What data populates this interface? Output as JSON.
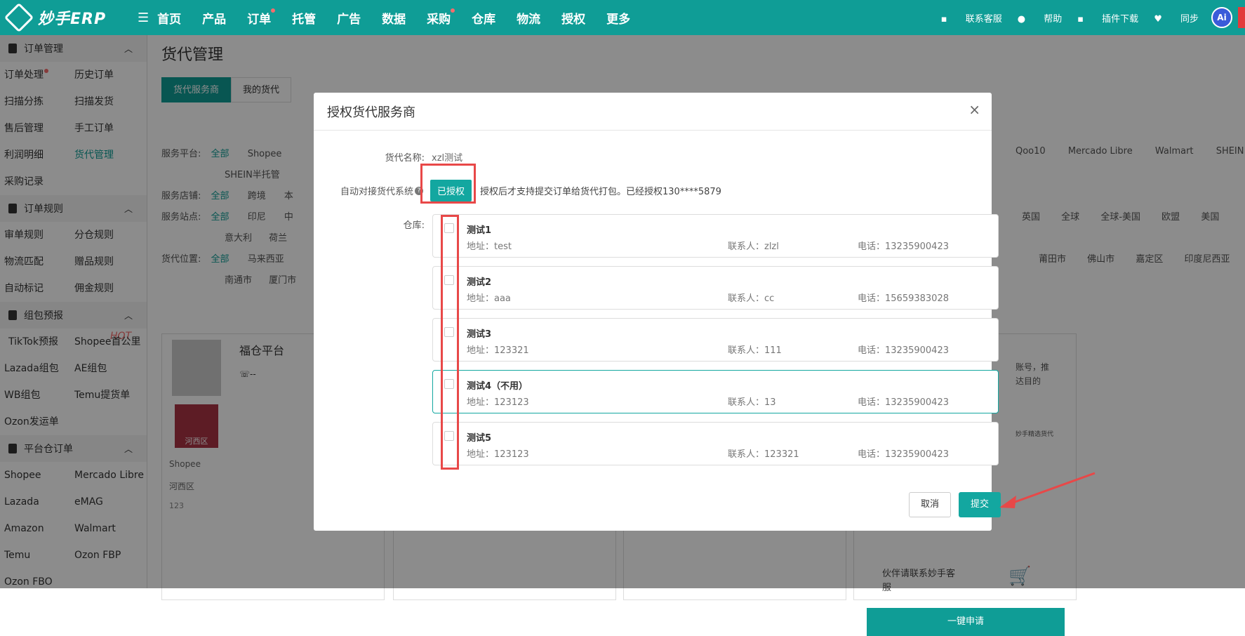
{
  "topbar": {
    "logo_text": "妙手ERP",
    "nav": [
      {
        "label": "首页",
        "dot": false
      },
      {
        "label": "产品",
        "dot": false
      },
      {
        "label": "订单",
        "dot": true
      },
      {
        "label": "托管",
        "dot": false
      },
      {
        "label": "广告",
        "dot": false
      },
      {
        "label": "数据",
        "dot": false
      },
      {
        "label": "采购",
        "dot": true
      },
      {
        "label": "仓库",
        "dot": false
      },
      {
        "label": "物流",
        "dot": false
      },
      {
        "label": "授权",
        "dot": false
      },
      {
        "label": "更多",
        "dot": false
      }
    ],
    "right": {
      "contact": "联系客服",
      "help": "帮助",
      "plugin": "插件下载",
      "sync": "同步",
      "avatar": "Ai"
    }
  },
  "sidebar": {
    "g1": "订单管理",
    "g1_items": [
      "订单处理",
      "历史订单",
      "扫描分拣",
      "扫描发货",
      "售后管理",
      "手工订单",
      "利润明细",
      "货代管理",
      "采购记录"
    ],
    "g2": "订单规则",
    "g2_items": [
      "审单规则",
      "分仓规则",
      "物流匹配",
      "赠品规则",
      "自动标记",
      "佣金规则"
    ],
    "g3": "组包预报",
    "g3_items": [
      "TikTok预报",
      "Shopee首公里",
      "Lazada组包",
      "AE组包",
      "WB组包",
      "Temu提货单",
      "Ozon发运单"
    ],
    "hot": "HOT",
    "g4": "平台仓订单",
    "g4_items": [
      "Shopee",
      "Mercado Libre",
      "Lazada",
      "eMAG",
      "Amazon",
      "Walmart",
      "Temu",
      "Ozon FBP",
      "Ozon FBO"
    ]
  },
  "main": {
    "title": "货代管理",
    "tabs": [
      "货代服务商",
      "我的货代"
    ],
    "f1": {
      "label": "服务平台:",
      "all": "全部",
      "v1": "Shopee",
      "v2": "SHEIN半托管",
      "r": [
        "Qoo10",
        "Mercado Libre",
        "Walmart",
        "SHEIN"
      ]
    },
    "f2": {
      "label": "服务店铺:",
      "all": "全部",
      "v1": "跨境",
      "v2": "本"
    },
    "f3": {
      "label": "服务站点:",
      "all": "全部",
      "v1": "印尼",
      "v2": "中",
      "r": [
        "英国",
        "全球",
        "全球-美国",
        "欧盟",
        "美国"
      ],
      "v3": "意大利",
      "v4": "荷兰"
    },
    "f4": {
      "label": "货代位置:",
      "all": "全部",
      "v1": "马来西亚",
      "r": [
        "莆田市",
        "佛山市",
        "嘉定区",
        "印度尼西亚"
      ],
      "v2": "南通市",
      "v3": "厦门市"
    },
    "card1": {
      "name": "福仓平台",
      "platform": "Shopee",
      "area": "河西区",
      "num": "123",
      "phone": "--",
      "img_label": "河西区"
    },
    "card4": {
      "t1": "账号，推",
      "t2": "达目的",
      "t3": "伙伴请联系妙手客",
      "t4": "服",
      "btn": "一键申请",
      "badge": "妙手精选货代"
    }
  },
  "modal": {
    "title": "授权货代服务商",
    "name_label": "货代名称:",
    "name_value": "xzl测试",
    "auto_label": "自动对接货代系统",
    "auth_btn": "已授权",
    "auth_note": "授权后才支持提交订单给货代打包。已经授权130****5879",
    "wh_label": "仓库:",
    "warehouses": [
      {
        "name": "测试1",
        "addr": "地址：test",
        "contact": "联系人：zlzl",
        "phone": "电话：13235900423"
      },
      {
        "name": "测试2",
        "addr": "地址：aaa",
        "contact": "联系人：cc",
        "phone": "电话：15659383028"
      },
      {
        "name": "测试3",
        "addr": "地址：123321",
        "contact": "联系人：111",
        "phone": "电话：13235900423"
      },
      {
        "name": "测试4（不用）",
        "addr": "地址：123123",
        "contact": "联系人：13",
        "phone": "电话：13235900423"
      },
      {
        "name": "测试5",
        "addr": "地址：123123",
        "contact": "联系人：123321",
        "phone": "电话：13235900423"
      }
    ],
    "cancel": "取消",
    "submit": "提交"
  },
  "colors": {
    "brand": "#0f9d96",
    "accent": "#13a7a0",
    "highlight": "#e84848"
  }
}
